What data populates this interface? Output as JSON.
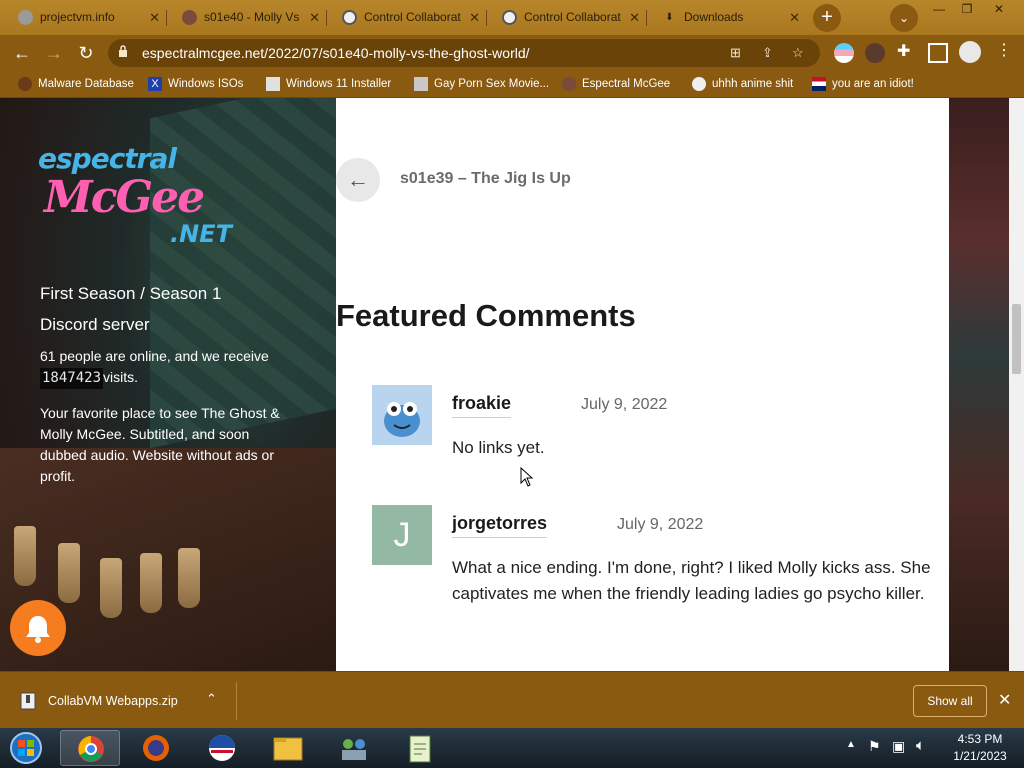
{
  "browser": {
    "tabs": [
      {
        "title": "projectvm.info",
        "active": false
      },
      {
        "title": "s01e40 - Molly Vs",
        "active": true
      },
      {
        "title": "Control Collaborat",
        "active": false
      },
      {
        "title": "Control Collaborat",
        "active": false
      },
      {
        "title": "Downloads",
        "active": false
      }
    ],
    "tab_close": "✕",
    "new_tab": "+",
    "url": "espectralmcgee.net/2022/07/s01e40-molly-vs-the-ghost-world/",
    "bookmarks": [
      {
        "label": "Malware Database"
      },
      {
        "label": "Windows ISOs"
      },
      {
        "label": "Windows 11 Installer"
      },
      {
        "label": "Gay Porn Sex Movie..."
      },
      {
        "label": "Espectral McGee"
      },
      {
        "label": "uhhh anime shit"
      },
      {
        "label": "you are an idiot!"
      }
    ],
    "accent": "#8a5a10"
  },
  "sidebar": {
    "logo": {
      "line1": "espectral",
      "line2": "McGee",
      "line3": ".NET"
    },
    "links": [
      "First Season / Season 1",
      "Discord server"
    ],
    "online_text": "61 people are online, and we receive",
    "visit_counter": "1847423",
    "visits_suffix": "visits.",
    "tagline_prefix": "Your favorite place to see ",
    "tagline_bold": "The Ghost & Molly McGee",
    "tagline_suffix": ". Subtitled, and soon dubbed audio. Website without ads or profit."
  },
  "content": {
    "prev_post": "s01e39 – The Jig Is Up",
    "section_title": "Featured Comments",
    "comments": [
      {
        "author": "froakie",
        "date": "July 9, 2022",
        "text": "No links yet.",
        "avatar": "frog-avatar"
      },
      {
        "author": "jorgetorres",
        "date": "July 9, 2022",
        "text": "What a nice ending. I'm done, right? I liked Molly kicks ass. She captivates me when the friendly leading ladies go psycho killer.",
        "avatar_letter": "J",
        "avatar_color": "#93b8a4"
      }
    ]
  },
  "downloads": {
    "file": "CollabVM Webapps.zip",
    "show_all": "Show all"
  },
  "taskbar": {
    "time": "4:53 PM",
    "date": "1/21/2023"
  }
}
